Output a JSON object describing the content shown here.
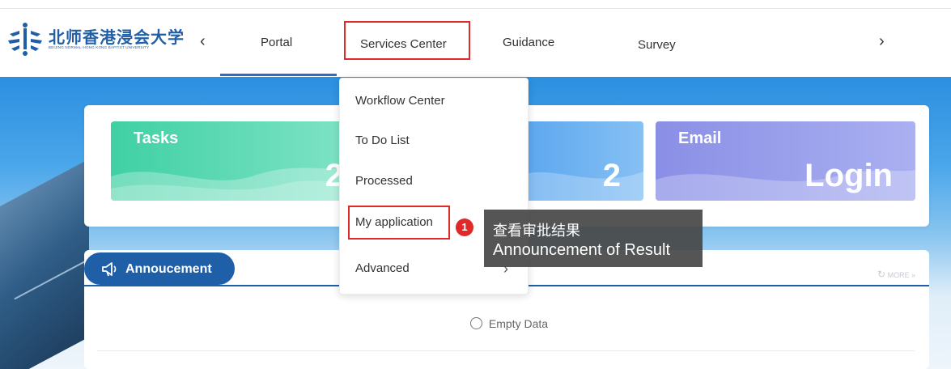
{
  "header": {
    "logo_cn": "北师香港浸会大学",
    "logo_en": "BEIJING NORMAL-HONG KONG BAPTIST UNIVERSITY",
    "left_arrow": "‹",
    "right_arrow": "›"
  },
  "nav": {
    "items": [
      {
        "label": "Portal"
      },
      {
        "label": "Services Center"
      },
      {
        "label": "Guidance"
      },
      {
        "label": "Survey"
      }
    ]
  },
  "dropdown": {
    "items": [
      {
        "label": "Workflow Center"
      },
      {
        "label": "To Do List"
      },
      {
        "label": "Processed"
      },
      {
        "label": "My application"
      },
      {
        "label": "Advanced"
      }
    ]
  },
  "cards": [
    {
      "title": "Tasks",
      "value": "2"
    },
    {
      "title": "",
      "value": "2"
    },
    {
      "title": "Email",
      "value": "Login"
    }
  ],
  "announcement": {
    "title": "Annoucement",
    "more": "MORE",
    "empty_text": "Empty Data"
  },
  "annotation": {
    "badge": "1",
    "line1": "查看审批结果",
    "line2": "Announcement of Result"
  },
  "colors": {
    "accent": "#1f5fa8",
    "highlight": "#e02a2a"
  }
}
